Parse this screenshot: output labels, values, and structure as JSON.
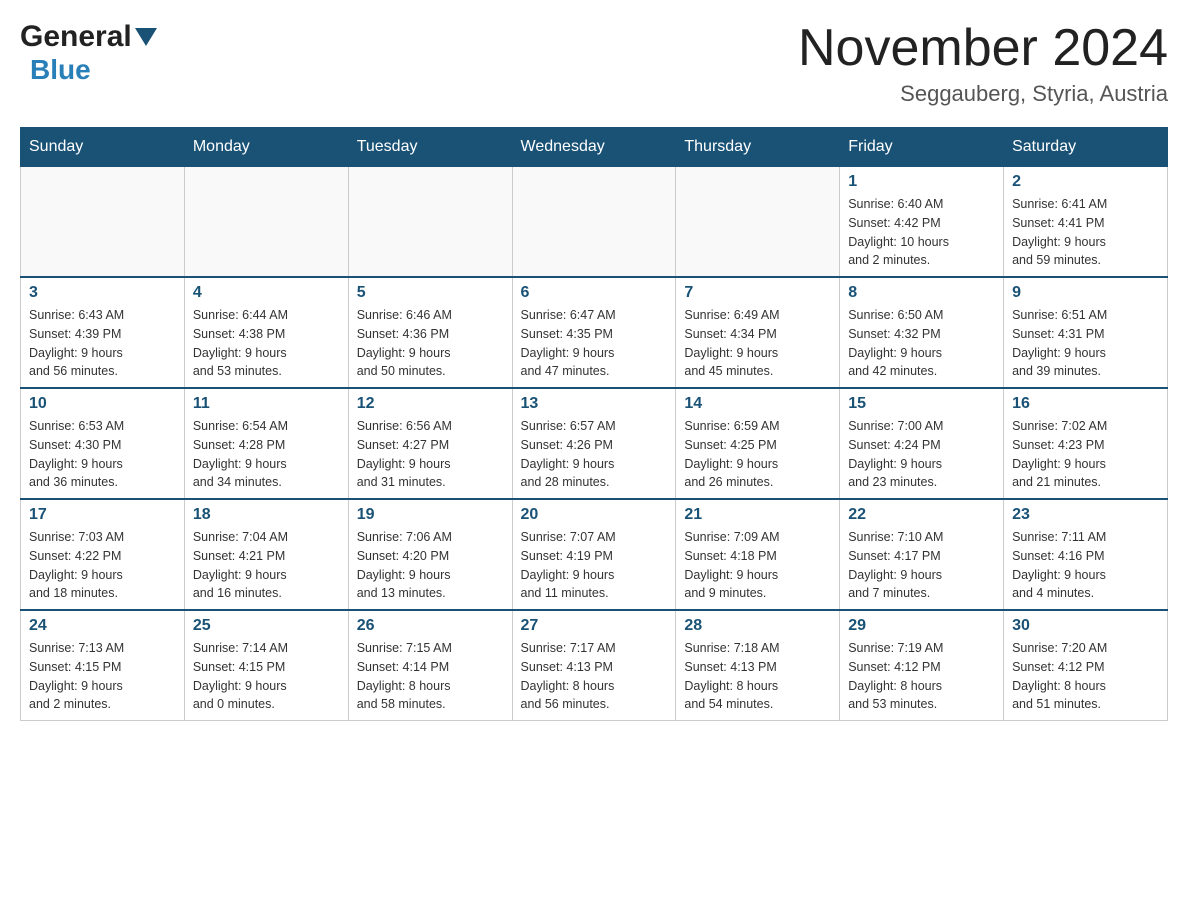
{
  "header": {
    "logo_general": "General",
    "logo_blue": "Blue",
    "month_title": "November 2024",
    "location": "Seggauberg, Styria, Austria"
  },
  "weekdays": [
    "Sunday",
    "Monday",
    "Tuesday",
    "Wednesday",
    "Thursday",
    "Friday",
    "Saturday"
  ],
  "weeks": [
    {
      "days": [
        {
          "num": "",
          "info": ""
        },
        {
          "num": "",
          "info": ""
        },
        {
          "num": "",
          "info": ""
        },
        {
          "num": "",
          "info": ""
        },
        {
          "num": "",
          "info": ""
        },
        {
          "num": "1",
          "info": "Sunrise: 6:40 AM\nSunset: 4:42 PM\nDaylight: 10 hours\nand 2 minutes."
        },
        {
          "num": "2",
          "info": "Sunrise: 6:41 AM\nSunset: 4:41 PM\nDaylight: 9 hours\nand 59 minutes."
        }
      ]
    },
    {
      "days": [
        {
          "num": "3",
          "info": "Sunrise: 6:43 AM\nSunset: 4:39 PM\nDaylight: 9 hours\nand 56 minutes."
        },
        {
          "num": "4",
          "info": "Sunrise: 6:44 AM\nSunset: 4:38 PM\nDaylight: 9 hours\nand 53 minutes."
        },
        {
          "num": "5",
          "info": "Sunrise: 6:46 AM\nSunset: 4:36 PM\nDaylight: 9 hours\nand 50 minutes."
        },
        {
          "num": "6",
          "info": "Sunrise: 6:47 AM\nSunset: 4:35 PM\nDaylight: 9 hours\nand 47 minutes."
        },
        {
          "num": "7",
          "info": "Sunrise: 6:49 AM\nSunset: 4:34 PM\nDaylight: 9 hours\nand 45 minutes."
        },
        {
          "num": "8",
          "info": "Sunrise: 6:50 AM\nSunset: 4:32 PM\nDaylight: 9 hours\nand 42 minutes."
        },
        {
          "num": "9",
          "info": "Sunrise: 6:51 AM\nSunset: 4:31 PM\nDaylight: 9 hours\nand 39 minutes."
        }
      ]
    },
    {
      "days": [
        {
          "num": "10",
          "info": "Sunrise: 6:53 AM\nSunset: 4:30 PM\nDaylight: 9 hours\nand 36 minutes."
        },
        {
          "num": "11",
          "info": "Sunrise: 6:54 AM\nSunset: 4:28 PM\nDaylight: 9 hours\nand 34 minutes."
        },
        {
          "num": "12",
          "info": "Sunrise: 6:56 AM\nSunset: 4:27 PM\nDaylight: 9 hours\nand 31 minutes."
        },
        {
          "num": "13",
          "info": "Sunrise: 6:57 AM\nSunset: 4:26 PM\nDaylight: 9 hours\nand 28 minutes."
        },
        {
          "num": "14",
          "info": "Sunrise: 6:59 AM\nSunset: 4:25 PM\nDaylight: 9 hours\nand 26 minutes."
        },
        {
          "num": "15",
          "info": "Sunrise: 7:00 AM\nSunset: 4:24 PM\nDaylight: 9 hours\nand 23 minutes."
        },
        {
          "num": "16",
          "info": "Sunrise: 7:02 AM\nSunset: 4:23 PM\nDaylight: 9 hours\nand 21 minutes."
        }
      ]
    },
    {
      "days": [
        {
          "num": "17",
          "info": "Sunrise: 7:03 AM\nSunset: 4:22 PM\nDaylight: 9 hours\nand 18 minutes."
        },
        {
          "num": "18",
          "info": "Sunrise: 7:04 AM\nSunset: 4:21 PM\nDaylight: 9 hours\nand 16 minutes."
        },
        {
          "num": "19",
          "info": "Sunrise: 7:06 AM\nSunset: 4:20 PM\nDaylight: 9 hours\nand 13 minutes."
        },
        {
          "num": "20",
          "info": "Sunrise: 7:07 AM\nSunset: 4:19 PM\nDaylight: 9 hours\nand 11 minutes."
        },
        {
          "num": "21",
          "info": "Sunrise: 7:09 AM\nSunset: 4:18 PM\nDaylight: 9 hours\nand 9 minutes."
        },
        {
          "num": "22",
          "info": "Sunrise: 7:10 AM\nSunset: 4:17 PM\nDaylight: 9 hours\nand 7 minutes."
        },
        {
          "num": "23",
          "info": "Sunrise: 7:11 AM\nSunset: 4:16 PM\nDaylight: 9 hours\nand 4 minutes."
        }
      ]
    },
    {
      "days": [
        {
          "num": "24",
          "info": "Sunrise: 7:13 AM\nSunset: 4:15 PM\nDaylight: 9 hours\nand 2 minutes."
        },
        {
          "num": "25",
          "info": "Sunrise: 7:14 AM\nSunset: 4:15 PM\nDaylight: 9 hours\nand 0 minutes."
        },
        {
          "num": "26",
          "info": "Sunrise: 7:15 AM\nSunset: 4:14 PM\nDaylight: 8 hours\nand 58 minutes."
        },
        {
          "num": "27",
          "info": "Sunrise: 7:17 AM\nSunset: 4:13 PM\nDaylight: 8 hours\nand 56 minutes."
        },
        {
          "num": "28",
          "info": "Sunrise: 7:18 AM\nSunset: 4:13 PM\nDaylight: 8 hours\nand 54 minutes."
        },
        {
          "num": "29",
          "info": "Sunrise: 7:19 AM\nSunset: 4:12 PM\nDaylight: 8 hours\nand 53 minutes."
        },
        {
          "num": "30",
          "info": "Sunrise: 7:20 AM\nSunset: 4:12 PM\nDaylight: 8 hours\nand 51 minutes."
        }
      ]
    }
  ]
}
